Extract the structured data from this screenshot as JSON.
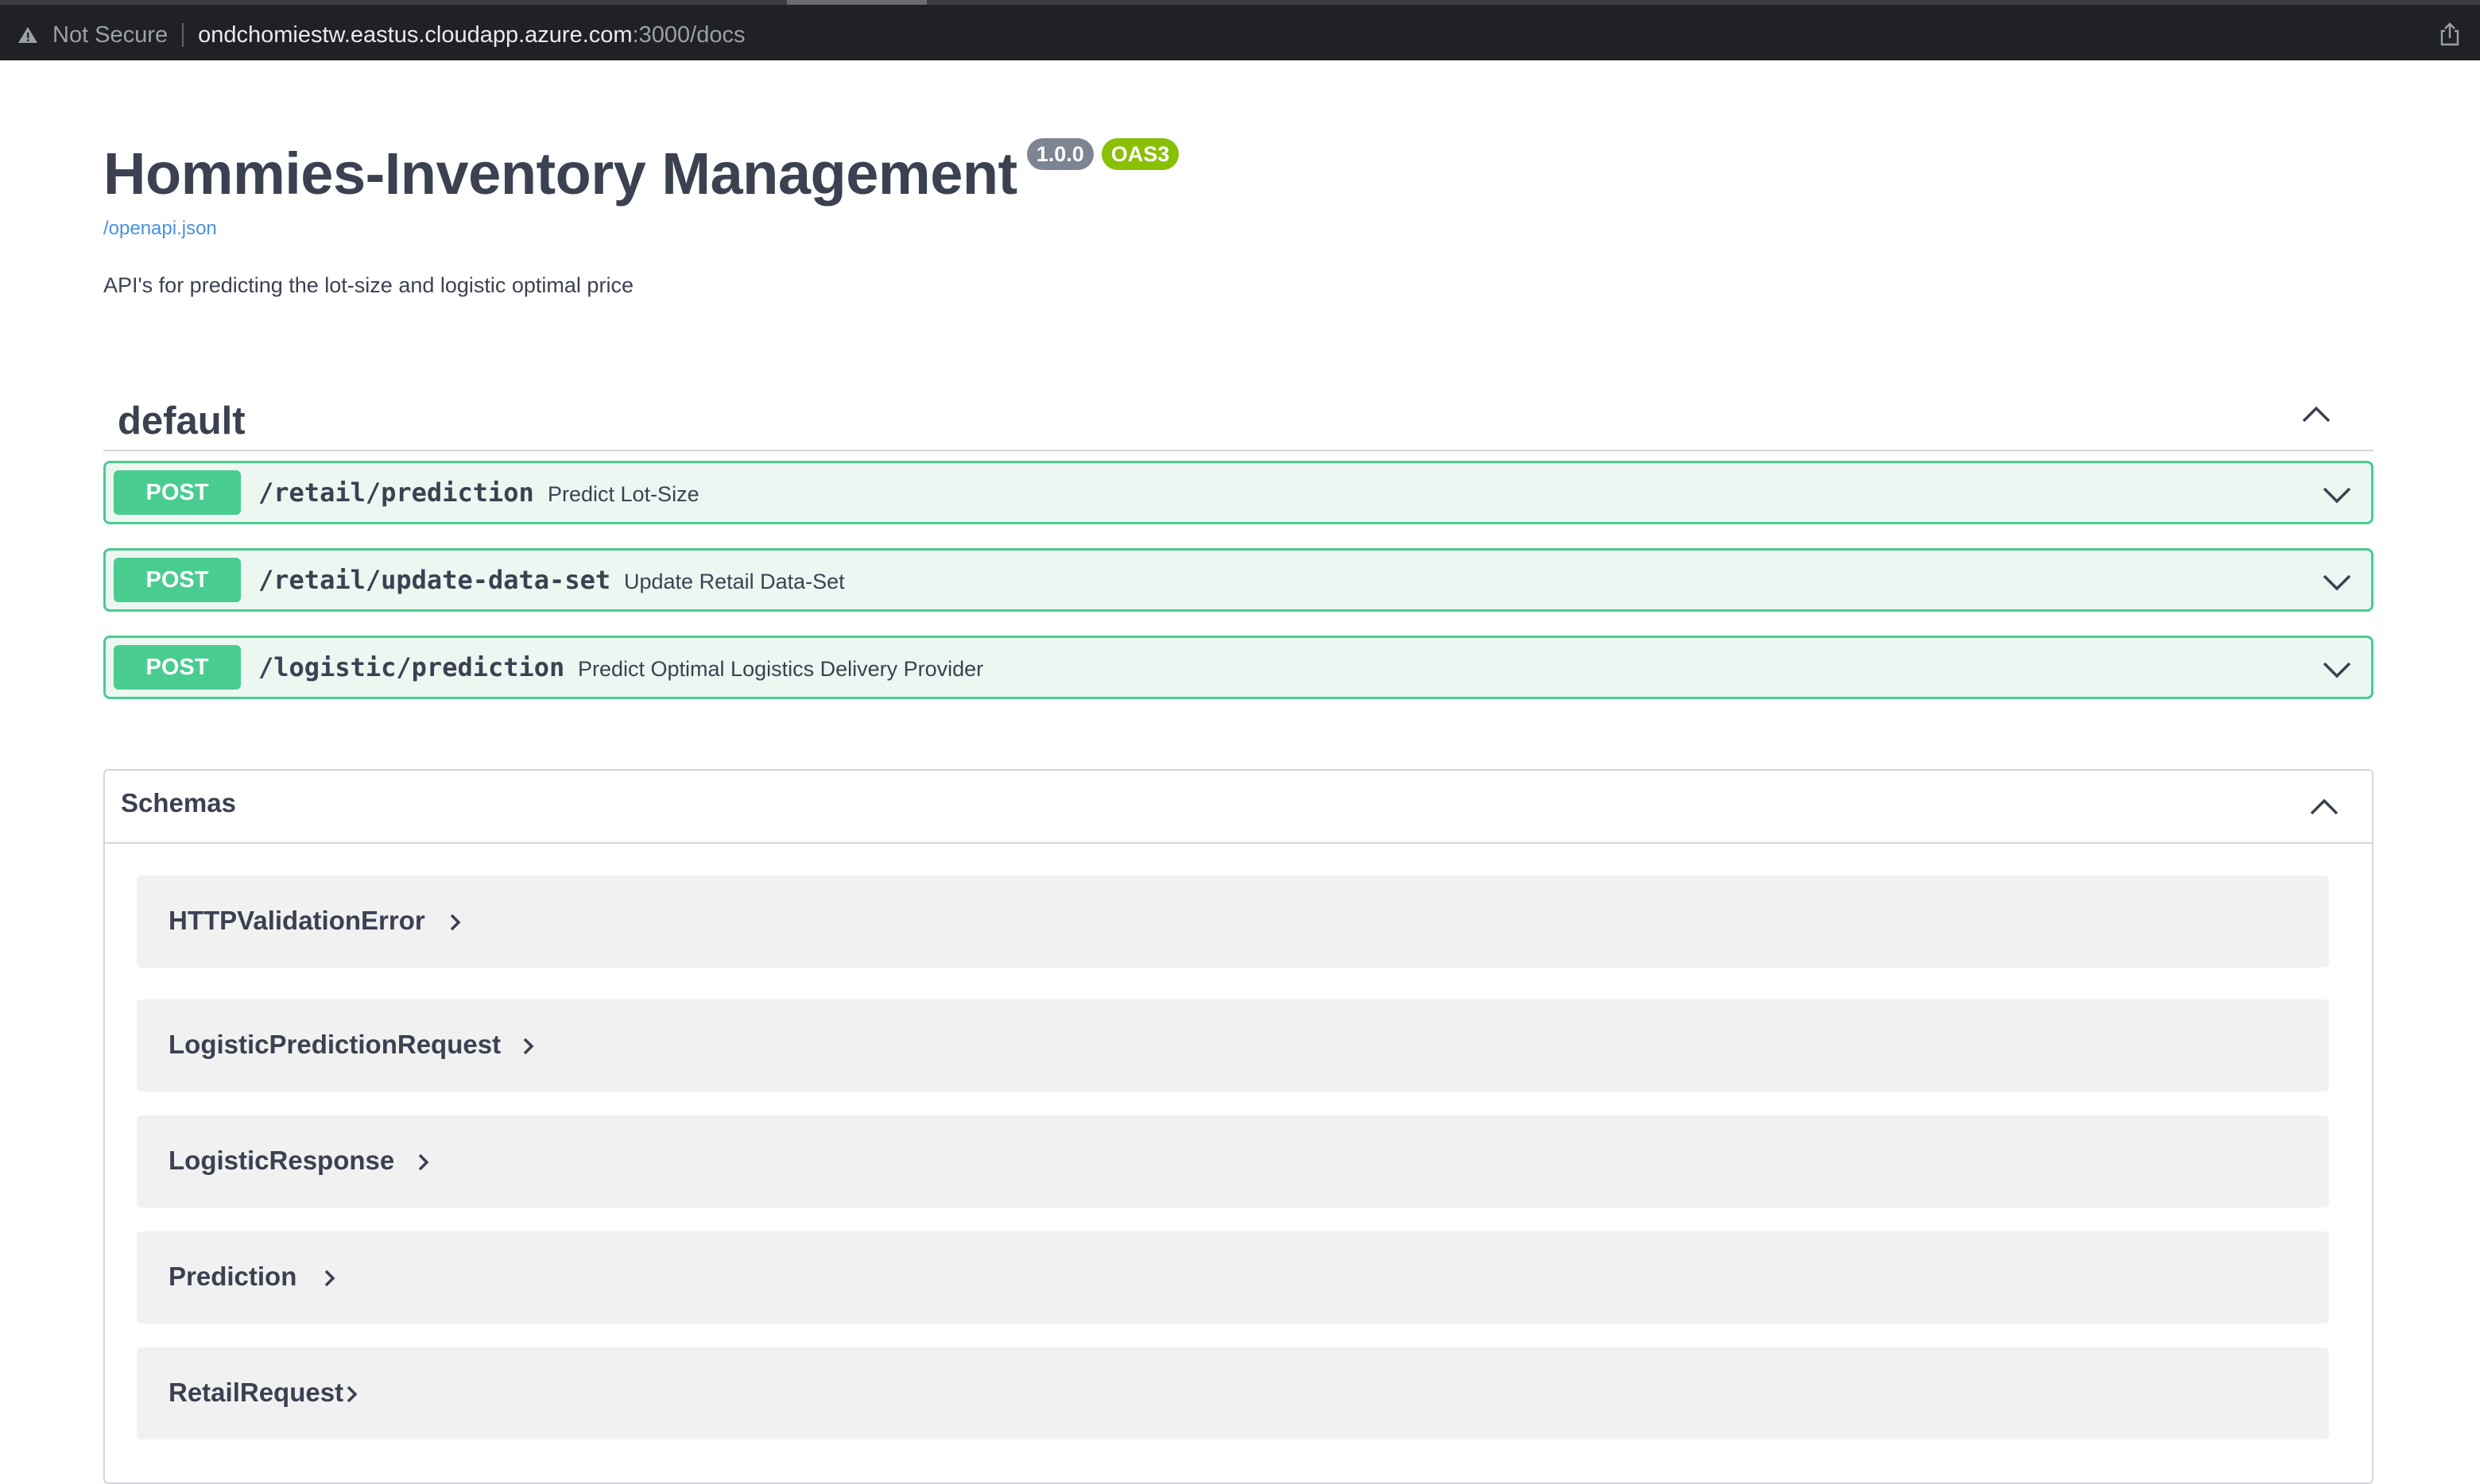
{
  "browser": {
    "security_label": "Not Secure",
    "url_host": "ondchomiestw.eastus.cloudapp.azure.com",
    "url_rest": ":3000/docs"
  },
  "info": {
    "title": "Hommies-Inventory Management",
    "version": "1.0.0",
    "oas": "OAS3",
    "spec_link": "/openapi.json",
    "description": "API's for predicting the lot-size and logistic optimal price"
  },
  "tag": {
    "name": "default",
    "operations": [
      {
        "method": "POST",
        "path": "/retail/prediction",
        "summary": "Predict Lot-Size"
      },
      {
        "method": "POST",
        "path": "/retail/update-data-set",
        "summary": "Update Retail Data-Set"
      },
      {
        "method": "POST",
        "path": "/logistic/prediction",
        "summary": "Predict Optimal Logistics Delivery Provider"
      }
    ]
  },
  "schemas": {
    "title": "Schemas",
    "models": [
      "HTTPValidationError",
      "LogisticPredictionRequest",
      "LogisticResponse",
      "Prediction",
      "RetailRequest"
    ]
  },
  "colors": {
    "post_green": "#49cc90",
    "post_bg": "#edf7f2",
    "link_blue": "#4990e2",
    "version_badge": "#7d8492",
    "oas_badge": "#89bf04"
  }
}
